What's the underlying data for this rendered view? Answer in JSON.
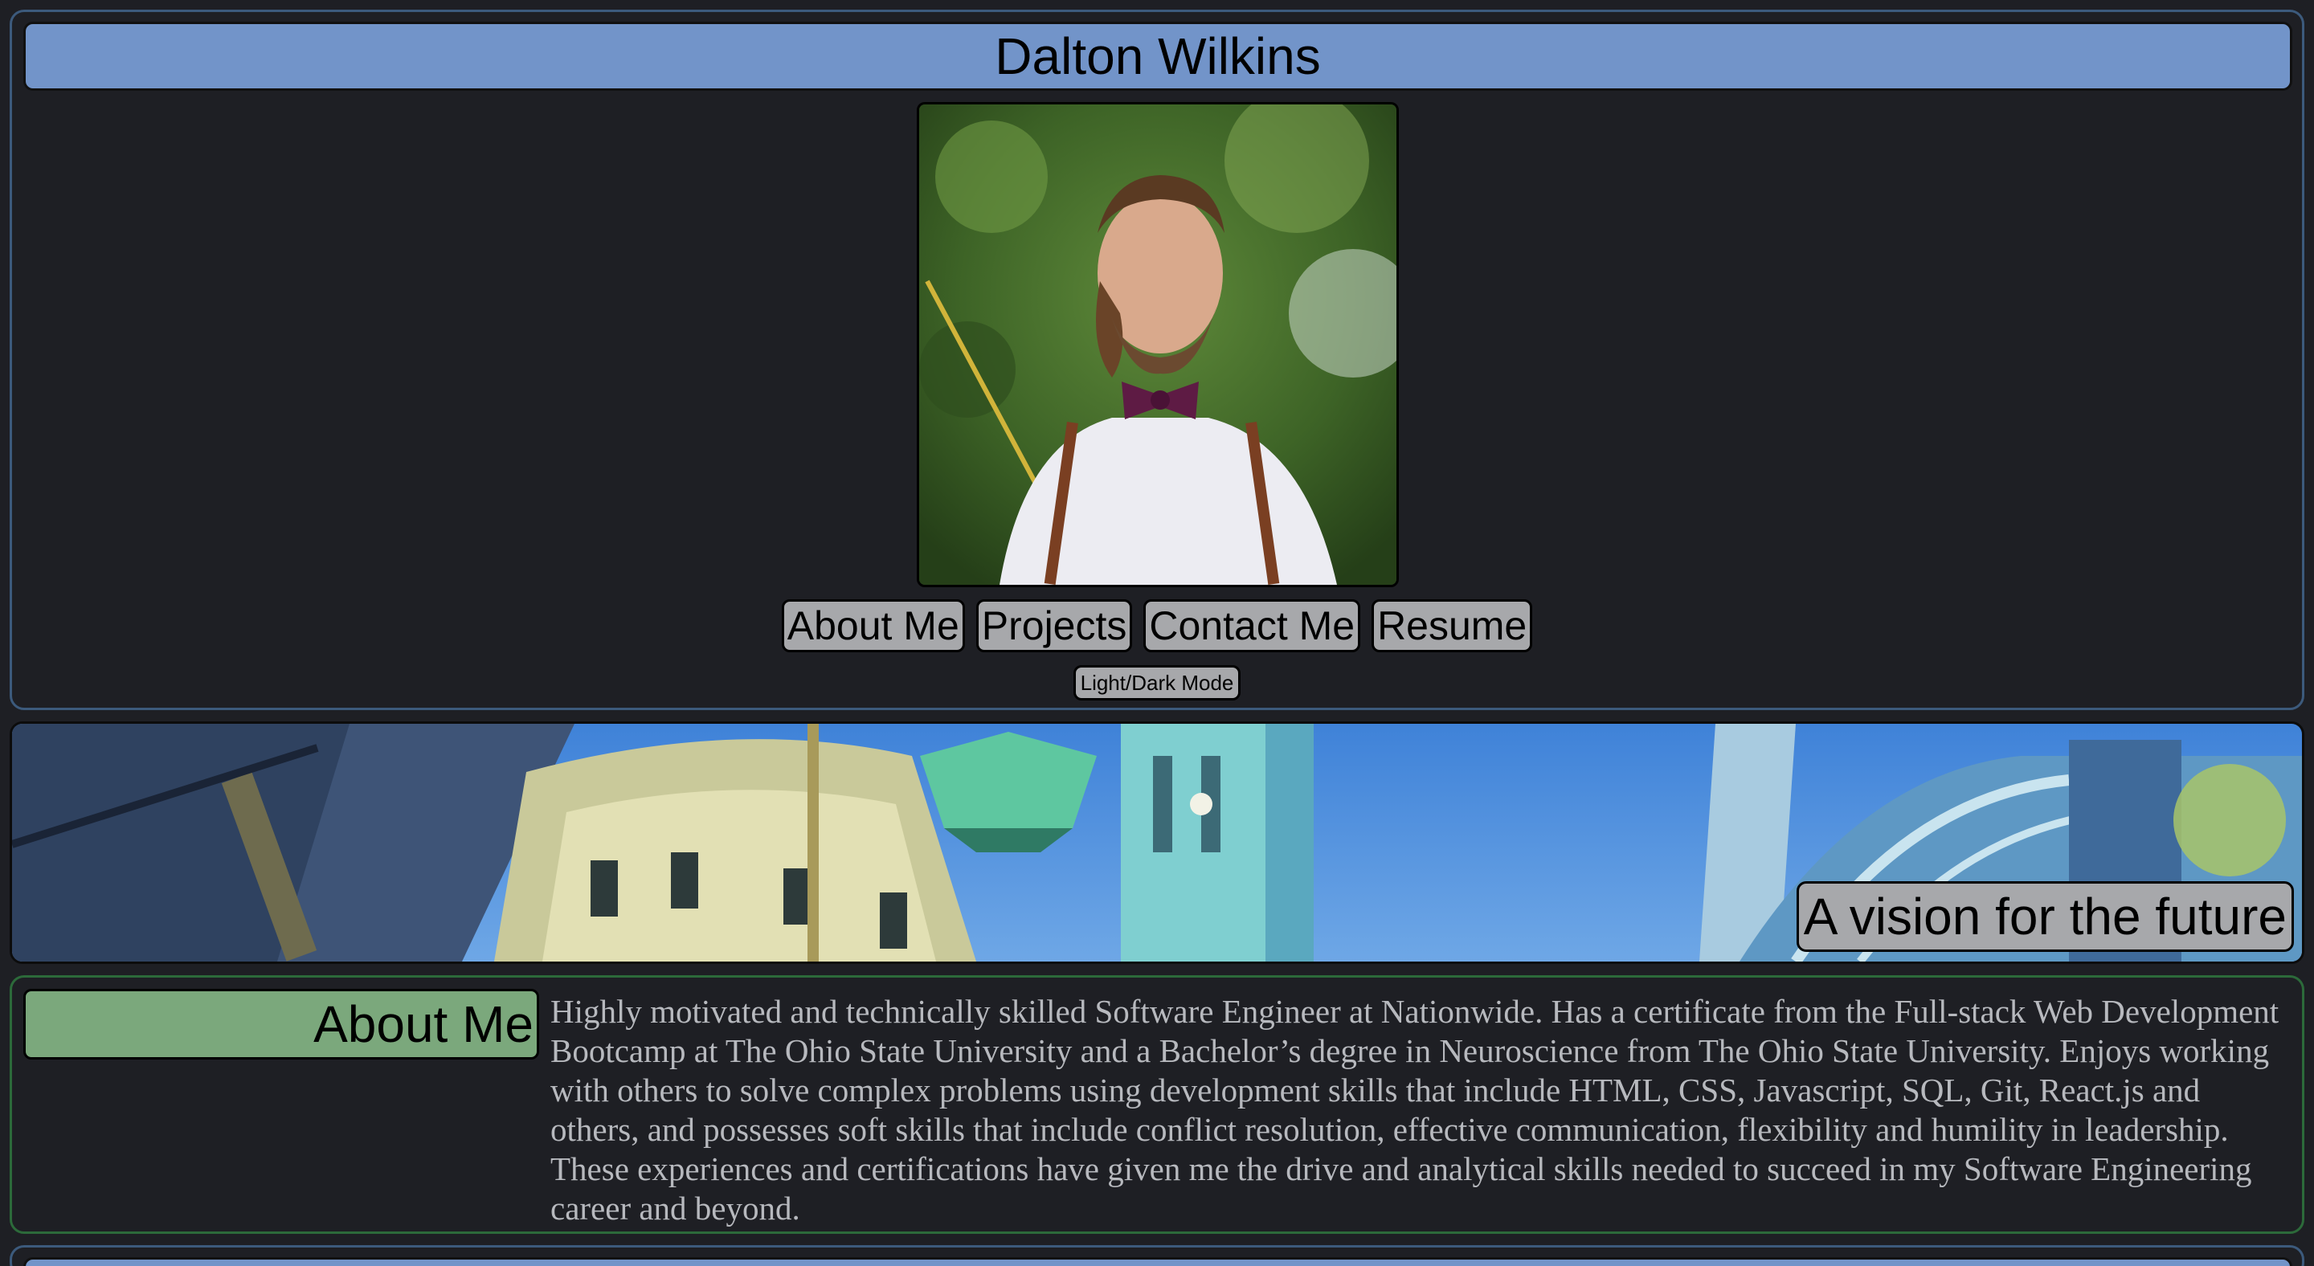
{
  "header": {
    "name": "Dalton Wilkins",
    "nav": [
      {
        "label": "About Me"
      },
      {
        "label": "Projects"
      },
      {
        "label": "Contact Me"
      },
      {
        "label": "Resume"
      }
    ],
    "mode_toggle_label": "Light/Dark Mode"
  },
  "banner": {
    "caption": "A vision for the future"
  },
  "about": {
    "heading": "About Me",
    "body": "Highly motivated and technically skilled Software Engineer at Nationwide. Has a certificate from the Full-stack Web Development Bootcamp at The Ohio State University and a Bachelor’s degree in Neuroscience from The Ohio State University. Enjoys working with others to solve complex problems using development skills that include HTML, CSS, Javascript, SQL, Git, React.js and others, and possesses soft skills that include conflict resolution, effective communication, flexibility and humility in leadership. These experiences and certifications have given me the drive and analytical skills needed to succeed in my Software Engineering career and beyond."
  },
  "colors": {
    "background": "#1e1f24",
    "title_bar": "#7294c9",
    "about_heading": "#7ba87c",
    "button": "#a7a8ab",
    "body_text": "#b7b9be"
  }
}
